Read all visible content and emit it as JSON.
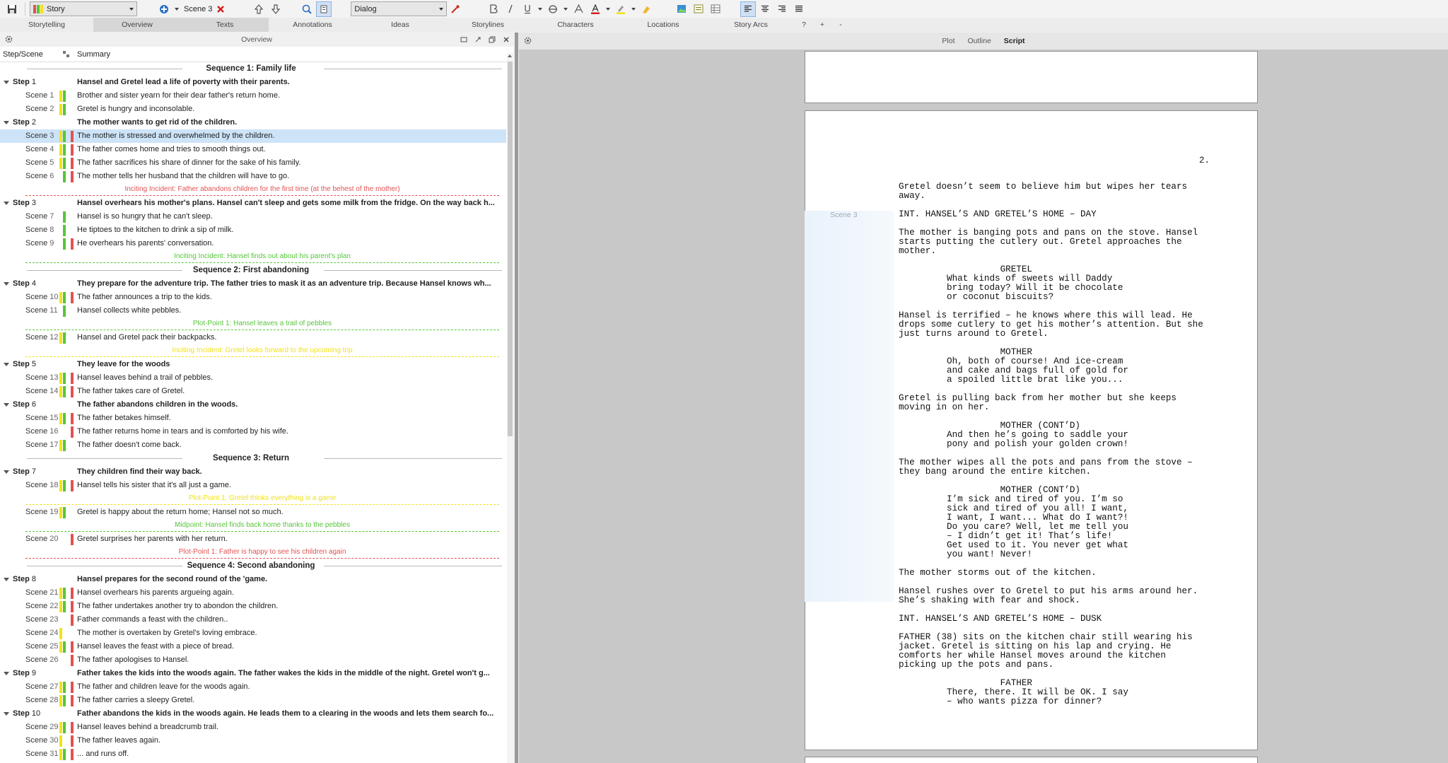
{
  "toolbar": {
    "story_combo": "Story",
    "scene_label": "Scene 3",
    "style_combo": "Dialog"
  },
  "tabs": [
    "Storytelling",
    "Overview",
    "Texts",
    "Annotations",
    "Ideas",
    "Storylines",
    "Characters",
    "Locations",
    "Story Arcs",
    "?",
    "+",
    "-"
  ],
  "left_panel": {
    "title": "Overview",
    "col_step_scene": "Step/Scene",
    "col_summary": "Summary"
  },
  "right_panel": {
    "views": [
      "Plot",
      "Outline",
      "Script"
    ],
    "page_number": "2.",
    "scene_marker": "Scene 3",
    "script_lines": [
      "Gretel doesn’t seem to believe him but wipes her tears",
      "away.",
      "",
      "INT. HANSEL’S AND GRETEL’S HOME – DAY",
      "",
      "The mother is banging pots and pans on the stove. Hansel",
      "starts putting the cutlery out. Gretel approaches the",
      "mother.",
      "",
      "                   GRETEL",
      "         What kinds of sweets will Daddy",
      "         bring today? Will it be chocolate",
      "         or coconut biscuits?",
      "",
      "Hansel is terrified – he knows where this will lead. He",
      "drops some cutlery to get his mother’s attention. But she",
      "just turns around to Gretel.",
      "",
      "                   MOTHER",
      "         Oh, both of course! And ice-cream",
      "         and cake and bags full of gold for",
      "         a spoiled little brat like you...",
      "",
      "Gretel is pulling back from her mother but she keeps",
      "moving in on her.",
      "",
      "                   MOTHER (CONT’D)",
      "         And then he’s going to saddle your",
      "         pony and polish your golden crown!",
      "",
      "The mother wipes all the pots and pans from the stove –",
      "they bang around the entire kitchen.",
      "",
      "                   MOTHER (CONT’D)",
      "         I’m sick and tired of you. I’m so",
      "         sick and tired of you all! I want,",
      "         I want, I want... What do I want?!",
      "         Do you care? Well, let me tell you",
      "         – I didn’t get it! That’s life!",
      "         Get used to it. You never get what",
      "         you want! Never!",
      "",
      "The mother storms out of the kitchen.",
      "",
      "Hansel rushes over to Gretel to put his arms around her.",
      "She’s shaking with fear and shock.",
      "",
      "INT. HANSEL’S AND GRETEL’S HOME – DUSK",
      "",
      "FATHER (38) sits on the kitchen chair still wearing his",
      "jacket. Gretel is sitting on his lap and crying. He",
      "comforts her while Hansel moves around the kitchen",
      "picking up the pots and pans.",
      "",
      "                   FATHER",
      "         There, there. It will be OK. I say",
      "         – who wants pizza for dinner?"
    ]
  },
  "colors": {
    "yellow": "#f2e21a",
    "green": "#56c63a",
    "red": "#e25252",
    "selection": "#cde3f7"
  },
  "outline": [
    {
      "type": "sequence",
      "title": "Sequence 1: Family life"
    },
    {
      "type": "step",
      "label": "Step",
      "num": "1",
      "summary": "Hansel and Gretel lead a life of poverty with their parents."
    },
    {
      "type": "scene",
      "label": "Scene",
      "num": "1",
      "bars": [
        "yellow",
        "green"
      ],
      "summary": "Brother and sister yearn for their dear father's return home."
    },
    {
      "type": "scene",
      "label": "Scene",
      "num": "2",
      "bars": [
        "yellow",
        "green"
      ],
      "summary": "Gretel is hungry and inconsolable."
    },
    {
      "type": "step",
      "label": "Step",
      "num": "2",
      "summary": "The mother wants to get rid of the children."
    },
    {
      "type": "scene",
      "label": "Scene",
      "num": "3",
      "bars": [
        "yellow",
        "green",
        "red"
      ],
      "summary": "The mother is stressed and overwhelmed by the children.",
      "selected": true
    },
    {
      "type": "scene",
      "label": "Scene",
      "num": "4",
      "bars": [
        "yellow",
        "green",
        "red"
      ],
      "summary": "The father comes home and tries to smooth things out."
    },
    {
      "type": "scene",
      "label": "Scene",
      "num": "5",
      "bars": [
        "yellow",
        "green",
        "red"
      ],
      "summary": "The father sacrifices his share of dinner for the sake of his family."
    },
    {
      "type": "scene",
      "label": "Scene",
      "num": "6",
      "bars": [
        "",
        "green",
        "red"
      ],
      "summary": "The mother tells her husband that the children will have to go."
    },
    {
      "type": "plot",
      "color": "red",
      "text": "Inciting Incident: Father abandons children for the first time (at the behest of the mother)"
    },
    {
      "type": "step",
      "label": "Step",
      "num": "3",
      "summary": "Hansel overhears his mother's plans. Hansel can't sleep and gets some milk from the fridge. On the way back h..."
    },
    {
      "type": "scene",
      "label": "Scene",
      "num": "7",
      "bars": [
        "",
        "green",
        ""
      ],
      "summary": "Hansel is so hungry that he can't sleep."
    },
    {
      "type": "scene",
      "label": "Scene",
      "num": "8",
      "bars": [
        "",
        "green",
        ""
      ],
      "summary": "He tiptoes to the kitchen to drink a sip of milk."
    },
    {
      "type": "scene",
      "label": "Scene",
      "num": "9",
      "bars": [
        "",
        "green",
        "red"
      ],
      "summary": "He overhears his parents' conversation."
    },
    {
      "type": "plot",
      "color": "green",
      "text": "Inciting Incident: Hansel finds out about his parent's plan"
    },
    {
      "type": "sequence",
      "title": "Sequence 2: First abandoning"
    },
    {
      "type": "step",
      "label": "Step",
      "num": "4",
      "summary": "They prepare for the adventure trip. The father tries to mask it as an adventure trip. Because Hansel knows wh..."
    },
    {
      "type": "scene",
      "label": "Scene",
      "num": "10",
      "bars": [
        "yellow",
        "green",
        "red"
      ],
      "summary": "The father announces a trip to the kids."
    },
    {
      "type": "scene",
      "label": "Scene",
      "num": "11",
      "bars": [
        "",
        "green",
        ""
      ],
      "summary": "Hansel collects white pebbles."
    },
    {
      "type": "plot",
      "color": "green",
      "text": "Plot-Point 1: Hansel leaves a trail of pebbles"
    },
    {
      "type": "scene",
      "label": "Scene",
      "num": "12",
      "bars": [
        "yellow",
        "green",
        ""
      ],
      "summary": "Hansel and Gretel pack their backpacks."
    },
    {
      "type": "plot",
      "color": "yellow",
      "text": "Inciting Incident: Gretel looks forward to the upcoming trip"
    },
    {
      "type": "step",
      "label": "Step",
      "num": "5",
      "summary": "They leave for the woods"
    },
    {
      "type": "scene",
      "label": "Scene",
      "num": "13",
      "bars": [
        "yellow",
        "green",
        "red"
      ],
      "summary": "Hansel leaves behind a trail of pebbles."
    },
    {
      "type": "scene",
      "label": "Scene",
      "num": "14",
      "bars": [
        "yellow",
        "green",
        "red"
      ],
      "summary": "The father takes care of Gretel."
    },
    {
      "type": "step",
      "label": "Step",
      "num": "6",
      "summary": "The father abandons children in the woods."
    },
    {
      "type": "scene",
      "label": "Scene",
      "num": "15",
      "bars": [
        "yellow",
        "green",
        "red"
      ],
      "summary": "The father betakes himself."
    },
    {
      "type": "scene",
      "label": "Scene",
      "num": "16",
      "bars": [
        "",
        "",
        "red"
      ],
      "summary": "The father returns home in tears and is comforted by his wife."
    },
    {
      "type": "scene",
      "label": "Scene",
      "num": "17",
      "bars": [
        "yellow",
        "green",
        ""
      ],
      "summary": "The father doesn't come back."
    },
    {
      "type": "sequence",
      "title": "Sequence 3: Return"
    },
    {
      "type": "step",
      "label": "Step",
      "num": "7",
      "summary": "They children find their way back."
    },
    {
      "type": "scene",
      "label": "Scene",
      "num": "18",
      "bars": [
        "yellow",
        "green",
        "red"
      ],
      "summary": "Hansel tells his sister that it's all just a game."
    },
    {
      "type": "plot",
      "color": "yellow",
      "text": "Plot-Point 1: Gretel thinks everything is a game"
    },
    {
      "type": "scene",
      "label": "Scene",
      "num": "19",
      "bars": [
        "yellow",
        "green",
        ""
      ],
      "summary": "Gretel is happy about the return home; Hansel not so much."
    },
    {
      "type": "plot",
      "color": "green",
      "text": "Midpoint: Hansel finds back home thanks to the pebbles"
    },
    {
      "type": "scene",
      "label": "Scene",
      "num": "20",
      "bars": [
        "",
        "",
        "red"
      ],
      "summary": "Gretel surprises her parents with her return."
    },
    {
      "type": "plot",
      "color": "red",
      "text": "Plot-Point 1: Father is happy to see his children again"
    },
    {
      "type": "sequence",
      "title": "Sequence 4: Second abandoning"
    },
    {
      "type": "step",
      "label": "Step",
      "num": "8",
      "summary": "Hansel prepares for the second round of the 'game."
    },
    {
      "type": "scene",
      "label": "Scene",
      "num": "21",
      "bars": [
        "yellow",
        "green",
        "red"
      ],
      "summary": "Hansel overhears his parents argueing again."
    },
    {
      "type": "scene",
      "label": "Scene",
      "num": "22",
      "bars": [
        "yellow",
        "green",
        "red"
      ],
      "summary": "The father undertakes another try to abondon the children."
    },
    {
      "type": "scene",
      "label": "Scene",
      "num": "23",
      "bars": [
        "",
        "",
        "red"
      ],
      "summary": "Father commands a feast with the children.."
    },
    {
      "type": "scene",
      "label": "Scene",
      "num": "24",
      "bars": [
        "yellow",
        "",
        ""
      ],
      "summary": "The mother is overtaken by Gretel's loving embrace."
    },
    {
      "type": "scene",
      "label": "Scene",
      "num": "25",
      "bars": [
        "yellow",
        "green",
        "red"
      ],
      "summary": "Hansel leaves the feast with a piece of bread."
    },
    {
      "type": "scene",
      "label": "Scene",
      "num": "26",
      "bars": [
        "",
        "",
        "red"
      ],
      "summary": "The father apologises to Hansel."
    },
    {
      "type": "step",
      "label": "Step",
      "num": "9",
      "summary": "Father takes the kids into the woods again. The father wakes the kids in the middle of the night. Gretel won't g..."
    },
    {
      "type": "scene",
      "label": "Scene",
      "num": "27",
      "bars": [
        "yellow",
        "green",
        "red"
      ],
      "summary": "The father and children leave for the woods again."
    },
    {
      "type": "scene",
      "label": "Scene",
      "num": "28",
      "bars": [
        "yellow",
        "green",
        "red"
      ],
      "summary": "The father carries a sleepy Gretel."
    },
    {
      "type": "step",
      "label": "Step",
      "num": "10",
      "summary": "Father abandons the kids in the woods again. He leads them to a clearing in the woods and lets them search fo..."
    },
    {
      "type": "scene",
      "label": "Scene",
      "num": "29",
      "bars": [
        "yellow",
        "green",
        "red"
      ],
      "summary": "Hansel leaves behind a breadcrumb trail."
    },
    {
      "type": "scene",
      "label": "Scene",
      "num": "30",
      "bars": [
        "yellow",
        "",
        "red"
      ],
      "summary": "The father leaves again."
    },
    {
      "type": "scene",
      "label": "Scene",
      "num": "31",
      "bars": [
        "yellow",
        "green",
        "red"
      ],
      "summary": "... and runs off."
    }
  ]
}
